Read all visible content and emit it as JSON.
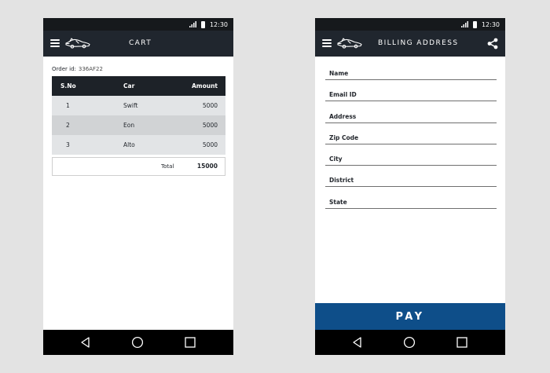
{
  "status_bar": {
    "time": "12:30"
  },
  "cart_screen": {
    "title": "CART",
    "order_label": "Order id:",
    "order_id": "336AF22",
    "table": {
      "headers": {
        "sno": "S.No",
        "car": "Car",
        "amount": "Amount"
      },
      "rows": [
        {
          "sno": "1",
          "car": "Swift",
          "amount": "5000"
        },
        {
          "sno": "2",
          "car": "Eon",
          "amount": "5000"
        },
        {
          "sno": "3",
          "car": "Alto",
          "amount": "5000"
        }
      ],
      "total_label": "Total",
      "total_value": "15000"
    }
  },
  "billing_screen": {
    "title": "BILLING ADDRESS",
    "fields": [
      {
        "label": "Name"
      },
      {
        "label": "Email ID"
      },
      {
        "label": "Address"
      },
      {
        "label": "Zip Code"
      },
      {
        "label": "City"
      },
      {
        "label": "District"
      },
      {
        "label": "State"
      }
    ],
    "pay_label": "PAY"
  },
  "icons": {
    "menu": "menu-icon",
    "logo": "car-logo-icon",
    "share": "share-icon",
    "back": "nav-back-icon",
    "home": "nav-home-icon",
    "recent": "nav-recent-icon",
    "signal": "signal-icon",
    "battery": "battery-icon"
  },
  "colors": {
    "background": "#e3e3e3",
    "status_bar": "#16191c",
    "app_bar": "#20262e",
    "table_header": "#1d2228",
    "row_light": "#e2e4e6",
    "row_dark": "#d1d3d5",
    "pay_button": "#0e4e89",
    "nav_bar": "#000000"
  }
}
